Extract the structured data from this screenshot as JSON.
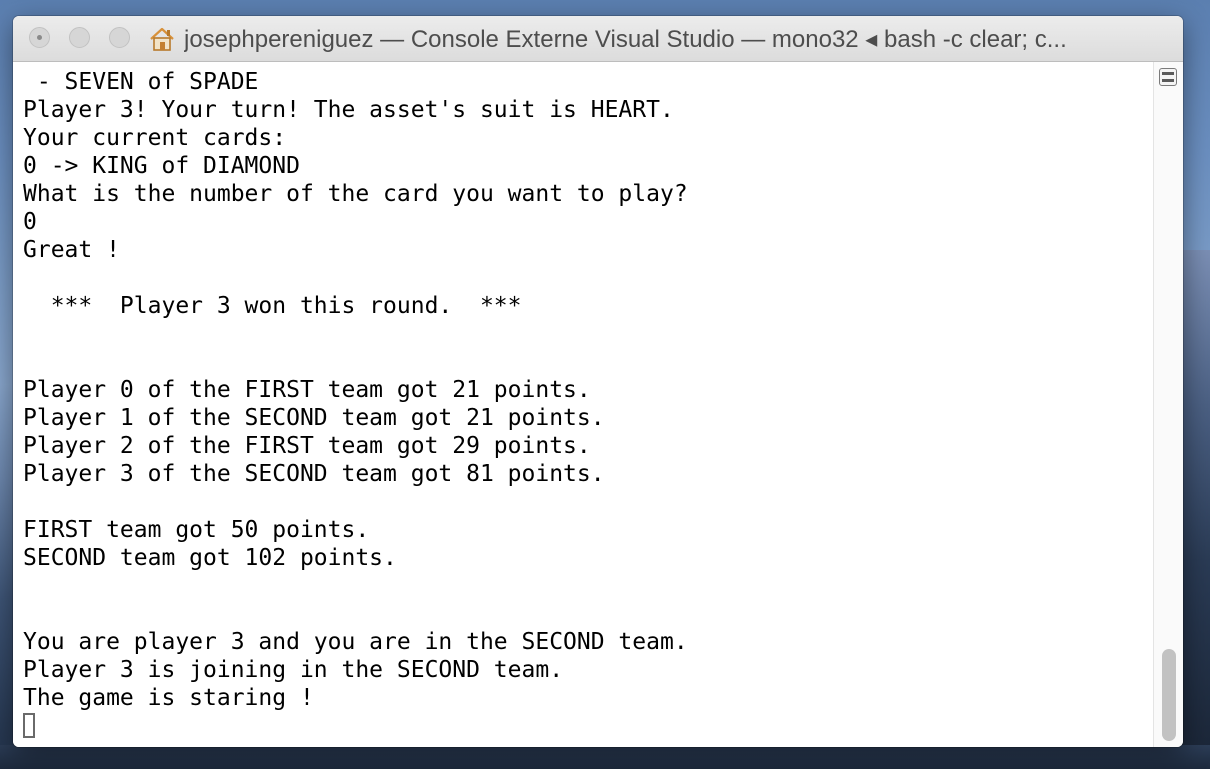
{
  "window": {
    "title": "josephpereniguez — Console Externe Visual Studio — mono32 ◂ bash -c clear; c..."
  },
  "icons": {
    "home": "home-icon",
    "split": "split-pane-icon"
  },
  "colors": {
    "titlebar": "#e3e3e3",
    "terminal_bg": "#ffffff",
    "terminal_text": "#000000",
    "title_text": "#4d4d4d"
  },
  "terminal": {
    "lines": [
      " - SEVEN of SPADE",
      "Player 3! Your turn! The asset's suit is HEART.",
      "Your current cards:",
      "0 -> KING of DIAMOND",
      "What is the number of the card you want to play?",
      "0",
      "Great !",
      "",
      "  ***  Player 3 won this round.  ***",
      "",
      "",
      "Player 0 of the FIRST team got 21 points.",
      "Player 1 of the SECOND team got 21 points.",
      "Player 2 of the FIRST team got 29 points.",
      "Player 3 of the SECOND team got 81 points.",
      "",
      "FIRST team got 50 points.",
      "SECOND team got 102 points.",
      "",
      "",
      "You are player 3 and you are in the SECOND team.",
      "Player 3 is joining in the SECOND team.",
      "The game is staring !"
    ]
  }
}
